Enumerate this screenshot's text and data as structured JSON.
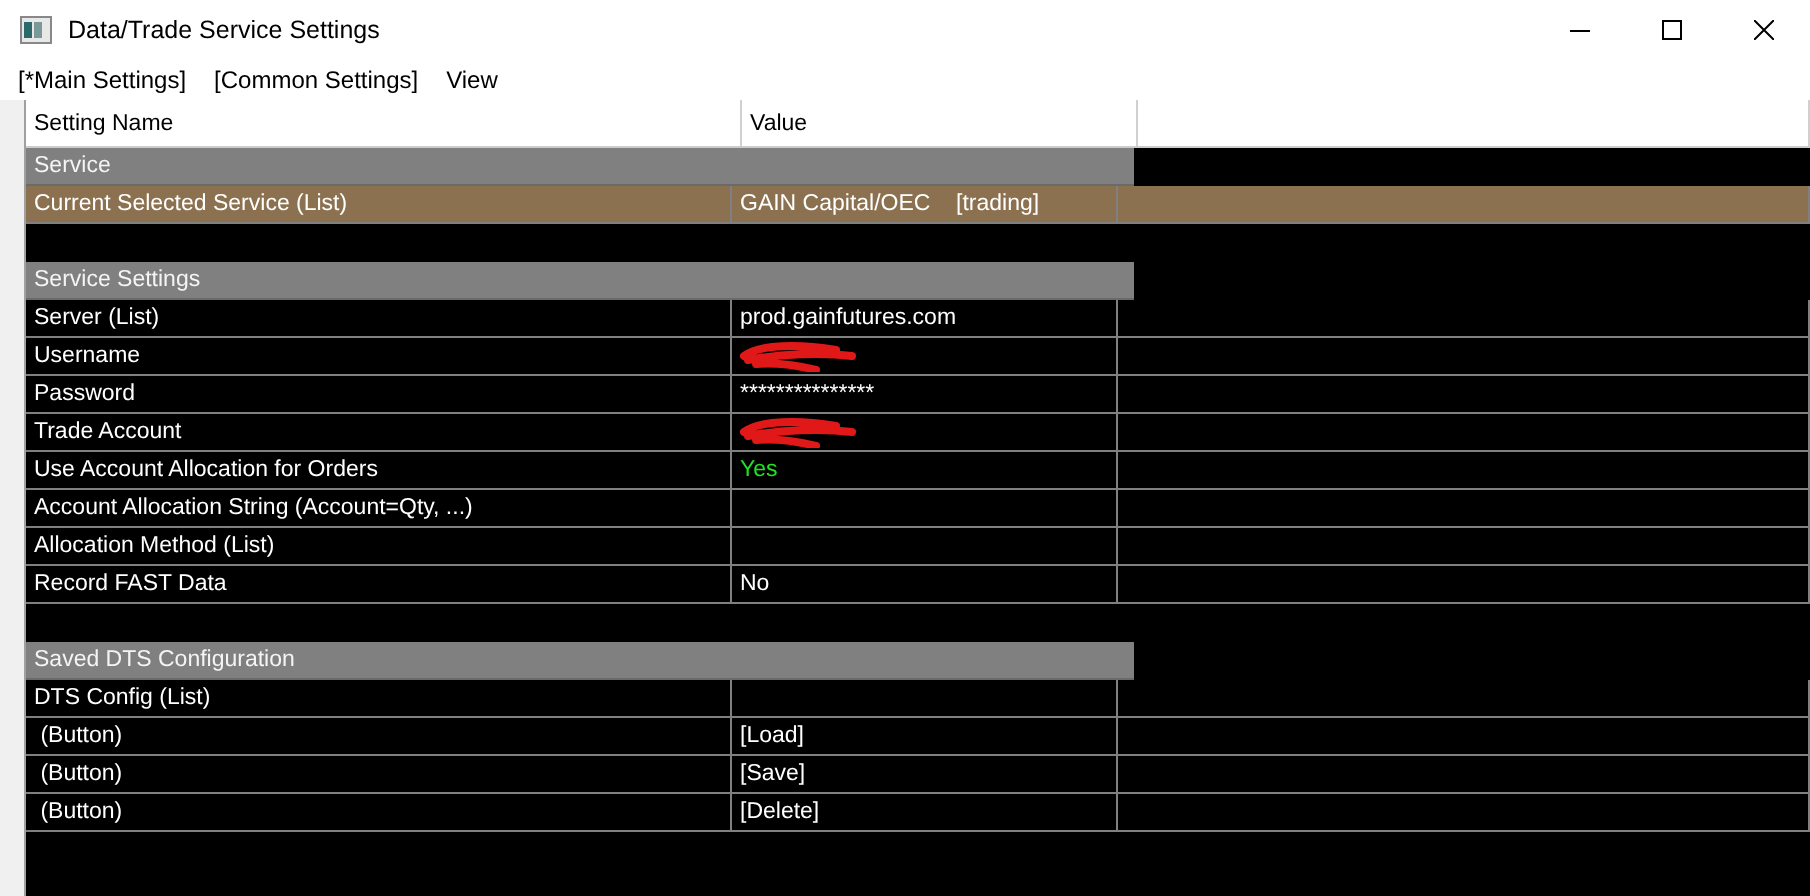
{
  "window": {
    "title": "Data/Trade Service Settings"
  },
  "menu": [
    "[*Main Settings]",
    "[Common Settings]",
    "View"
  ],
  "table": {
    "columns": [
      "Setting Name",
      "Value"
    ],
    "rows": [
      {
        "kind": "section",
        "name": "Service"
      },
      {
        "kind": "setting",
        "name": "Current Selected Service (List)",
        "value": "GAIN Capital/OEC    [trading]",
        "selected": true
      },
      {
        "kind": "blank"
      },
      {
        "kind": "section",
        "name": "Service Settings"
      },
      {
        "kind": "setting",
        "name": "Server (List)",
        "value": "prod.gainfutures.com",
        "selected": false
      },
      {
        "kind": "setting",
        "name": "Username",
        "redacted": true,
        "selected": false
      },
      {
        "kind": "setting",
        "name": "Password",
        "value": "***************",
        "selected": false
      },
      {
        "kind": "setting",
        "name": "Trade Account",
        "redacted": true,
        "selected": false
      },
      {
        "kind": "setting",
        "name": "Use Account Allocation for Orders",
        "value": "Yes",
        "color": "#22e022",
        "selected": false
      },
      {
        "kind": "setting",
        "name": "Account Allocation String (Account=Qty, ...)",
        "selected": false
      },
      {
        "kind": "setting",
        "name": "Allocation Method (List)",
        "selected": false
      },
      {
        "kind": "setting",
        "name": "Record FAST Data",
        "value": "No",
        "selected": false
      },
      {
        "kind": "blank"
      },
      {
        "kind": "section",
        "name": "Saved DTS Configuration"
      },
      {
        "kind": "setting",
        "name": "DTS Config (List)",
        "selected": false
      },
      {
        "kind": "setting",
        "name": " (Button)",
        "value": "[Load]",
        "selected": false
      },
      {
        "kind": "setting",
        "name": " (Button)",
        "value": "[Save]",
        "selected": false
      },
      {
        "kind": "setting",
        "name": " (Button)",
        "value": "[Delete]",
        "selected": false
      }
    ]
  }
}
